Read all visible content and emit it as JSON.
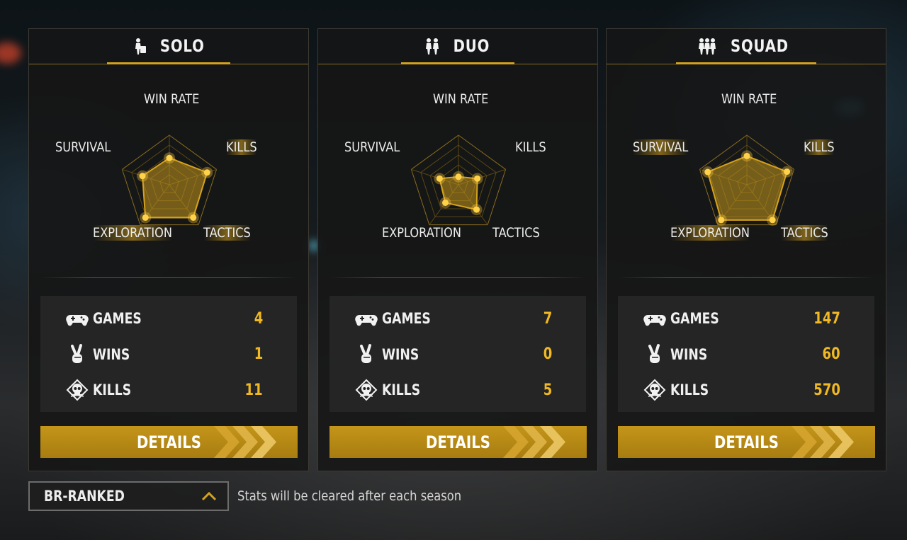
{
  "panels": [
    {
      "id": "solo",
      "title": "SOLO",
      "radar_labels": {
        "win_rate": "WIN RATE",
        "kills": "KILLS",
        "tactics": "TACTICS",
        "exploration": "EXPLORATION",
        "survival": "SURVIVAL"
      },
      "highlighted_labels": [
        "kills",
        "tactics",
        "exploration"
      ],
      "radar_values": {
        "win_rate": 0.54,
        "kills": 0.8,
        "tactics": 0.82,
        "exploration": 0.82,
        "survival": 0.57
      },
      "stats": [
        {
          "label": "GAMES",
          "value": "4",
          "icon": "gamepad-icon"
        },
        {
          "label": "WINS",
          "value": "1",
          "icon": "victory-hand-icon"
        },
        {
          "label": "KILLS",
          "value": "11",
          "icon": "skull-icon"
        }
      ],
      "details_label": "DETAILS"
    },
    {
      "id": "duo",
      "title": "DUO",
      "radar_labels": {
        "win_rate": "WIN RATE",
        "kills": "KILLS",
        "tactics": "TACTICS",
        "exploration": "EXPLORATION",
        "survival": "SURVIVAL"
      },
      "highlighted_labels": [],
      "radar_values": {
        "win_rate": 0.16,
        "kills": 0.4,
        "tactics": 0.62,
        "exploration": 0.45,
        "survival": 0.4
      },
      "stats": [
        {
          "label": "GAMES",
          "value": "7",
          "icon": "gamepad-icon"
        },
        {
          "label": "WINS",
          "value": "0",
          "icon": "victory-hand-icon"
        },
        {
          "label": "KILLS",
          "value": "5",
          "icon": "skull-icon"
        }
      ],
      "details_label": "DETAILS"
    },
    {
      "id": "squad",
      "title": "SQUAD",
      "radar_labels": {
        "win_rate": "WIN RATE",
        "kills": "KILLS",
        "tactics": "TACTICS",
        "exploration": "EXPLORATION",
        "survival": "SURVIVAL"
      },
      "highlighted_labels": [
        "kills",
        "tactics",
        "exploration",
        "survival"
      ],
      "radar_values": {
        "win_rate": 0.58,
        "kills": 0.85,
        "tactics": 0.88,
        "exploration": 0.88,
        "survival": 0.83
      },
      "stats": [
        {
          "label": "GAMES",
          "value": "147",
          "icon": "gamepad-icon"
        },
        {
          "label": "WINS",
          "value": "60",
          "icon": "victory-hand-icon"
        },
        {
          "label": "KILLS",
          "value": "570",
          "icon": "skull-icon"
        }
      ],
      "details_label": "DETAILS"
    }
  ],
  "mode_selector": {
    "label": "BR-RANKED",
    "icon": "chevron-up-icon"
  },
  "season_note": "Stats will be cleared after each season",
  "colors": {
    "accent": "#d4a21e",
    "value": "#f0b823",
    "button": "#b88a14"
  }
}
